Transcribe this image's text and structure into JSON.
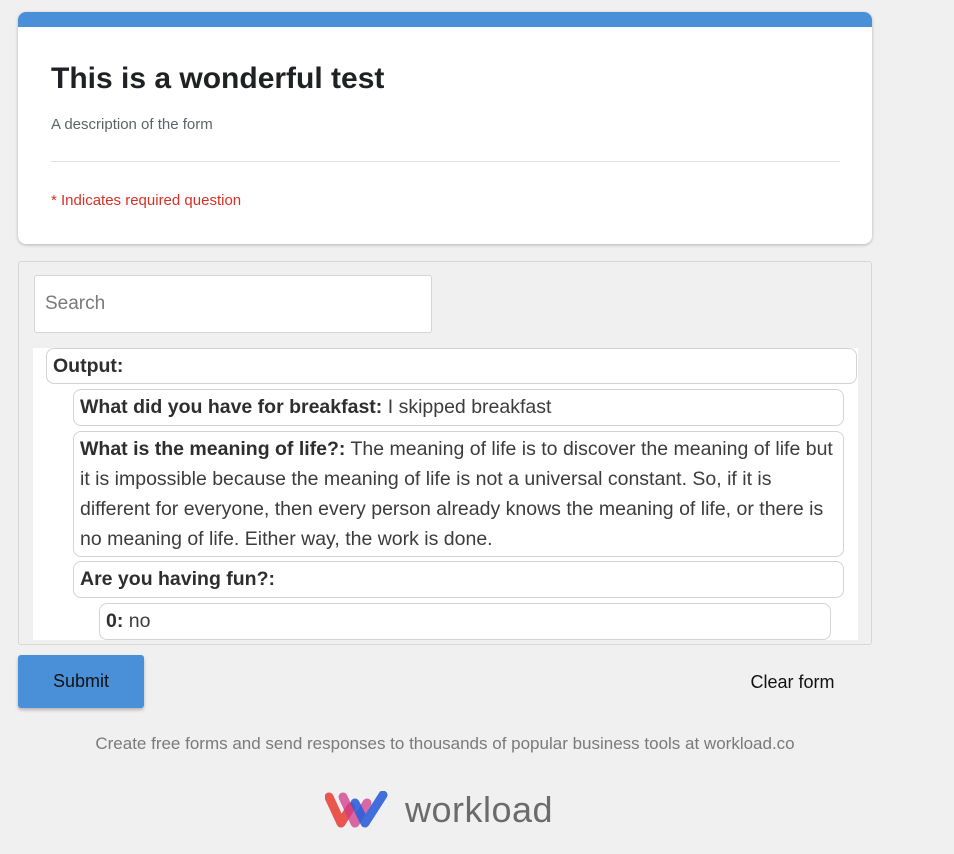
{
  "form": {
    "title": "This is a wonderful test",
    "description": "A description of the form",
    "required_note": "* Indicates required question",
    "accent_color": "#4a90d9",
    "required_color": "#d93025"
  },
  "search": {
    "placeholder": "Search",
    "value": ""
  },
  "output": {
    "label": "Output:",
    "items": [
      {
        "key": "What did you have for breakfast:",
        "value": "I skipped breakfast"
      },
      {
        "key": "What is the meaning of life?:",
        "value": "The meaning of life is to discover the meaning of life but it is impossible because the meaning of life is not a universal constant. So, if it is different for everyone, then every person already knows the meaning of life, or there is no meaning of life. Either way, the work is done."
      },
      {
        "key": "Are you having fun?:",
        "value": ""
      },
      {
        "key": "0:",
        "value": "no"
      }
    ]
  },
  "actions": {
    "submit_label": "Submit",
    "clear_label": "Clear form"
  },
  "footer": {
    "note": "Create free forms and send responses to thousands of popular business tools at workload.co",
    "logo_text": "workload",
    "logo_icon": "workload-logo-icon"
  }
}
